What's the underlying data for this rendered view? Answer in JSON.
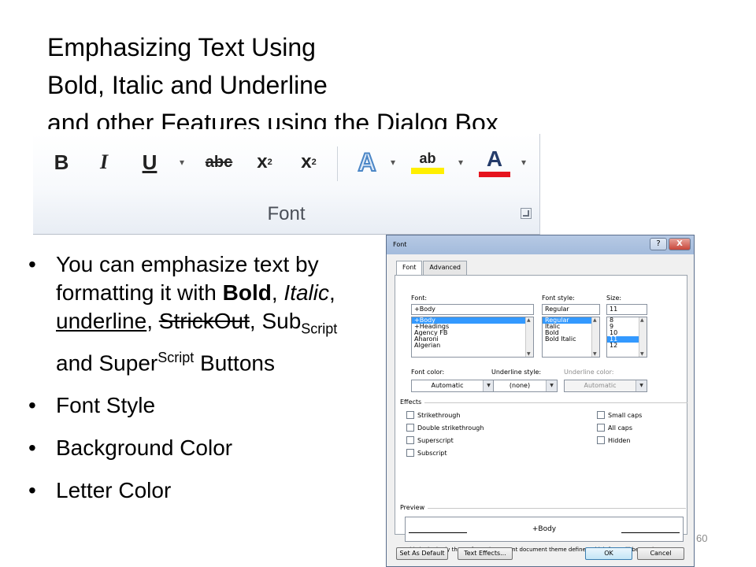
{
  "slide": {
    "title_lines": [
      "Emphasizing Text Using",
      "Bold, Italic and Underline",
      "and other Features using the Dialog Box"
    ],
    "page_number": "60"
  },
  "ribbon": {
    "group_label": "Font",
    "buttons": {
      "bold": "B",
      "italic": "I",
      "underline": "U",
      "strikethrough": "abc",
      "subscript_base": "x",
      "subscript_mark": "2",
      "superscript_base": "x",
      "superscript_mark": "2",
      "text_effects": "A",
      "highlight": "ab",
      "font_color": "A",
      "dropdown_arrow": "▾"
    },
    "highlight_color": "#ffef00",
    "font_color_bar": "#e6141e"
  },
  "bullets": {
    "b1": {
      "prefix": "You can emphasize text by formatting it with ",
      "bold": "Bold",
      "sep1": ", ",
      "italic": "Italic",
      "sep2": ",  ",
      "underline": "underline",
      "sep3": ",",
      "strike": "StrickOut",
      "sep4": ", Sub",
      "sub": "Script",
      "mid": " and Super",
      "sup": "Script",
      "suffix": " Buttons"
    },
    "b2": "Font Style",
    "b3": "Background Color",
    "b4": "Letter Color"
  },
  "dialog": {
    "title": "Font",
    "help_label": "?",
    "close_label": "X",
    "tabs": [
      "Font",
      "Advanced"
    ],
    "font_label": "Font:",
    "font_value": "+Body",
    "font_list": [
      "+Body",
      "+Headings",
      "Agency FB",
      "Aharoni",
      "Algerian"
    ],
    "style_label": "Font style:",
    "style_value": "Regular",
    "style_list": [
      "Regular",
      "Italic",
      "Bold",
      "Bold Italic"
    ],
    "size_label": "Size:",
    "size_value": "11",
    "size_list": [
      "8",
      "9",
      "10",
      "11",
      "12"
    ],
    "font_color_label": "Font color:",
    "font_color_value": "Automatic",
    "underline_style_label": "Underline style:",
    "underline_style_value": "(none)",
    "underline_color_label": "Underline color:",
    "underline_color_value": "Automatic",
    "effects_label": "Effects",
    "effects_left": [
      "Strikethrough",
      "Double strikethrough",
      "Superscript",
      "Subscript"
    ],
    "effects_right": [
      "Small caps",
      "All caps",
      "Hidden"
    ],
    "preview_label": "Preview",
    "preview_text": "+Body",
    "preview_note": "This is the body theme font. The current document theme defines which font will be used.",
    "buttons": [
      "Set As Default",
      "Text Effects...",
      "OK",
      "Cancel"
    ]
  }
}
